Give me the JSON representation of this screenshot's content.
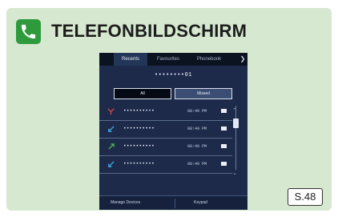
{
  "header": {
    "title": "TELEFONBILDSCHIRM",
    "icon": "phone-icon",
    "icon_color": "#2f9a3c"
  },
  "screen": {
    "tabs": [
      "Recents",
      "Favourites",
      "Phonebook"
    ],
    "active_tab": "Recents",
    "more_icon": "chevron-right-icon",
    "number": "••••••••01",
    "filters": [
      "All",
      "Missed"
    ],
    "calls": [
      {
        "icon": "missed-call-icon",
        "icon_color": "#d6454b",
        "name": "••••••••••",
        "time": "08:49 PM"
      },
      {
        "icon": "incoming-call-icon",
        "icon_color": "#41a6d8",
        "name": "••••••••••",
        "time": "08:49 PM"
      },
      {
        "icon": "outgoing-call-icon",
        "icon_color": "#4fb34f",
        "name": "••••••••••",
        "time": "08:49 PM"
      },
      {
        "icon": "incoming-call-icon",
        "icon_color": "#41a6d8",
        "name": "••••••••••",
        "time": "08:49 PM"
      }
    ],
    "bottom_left": "Manage Devices",
    "bottom_right": "Keypad"
  },
  "page_ref": "S.48"
}
